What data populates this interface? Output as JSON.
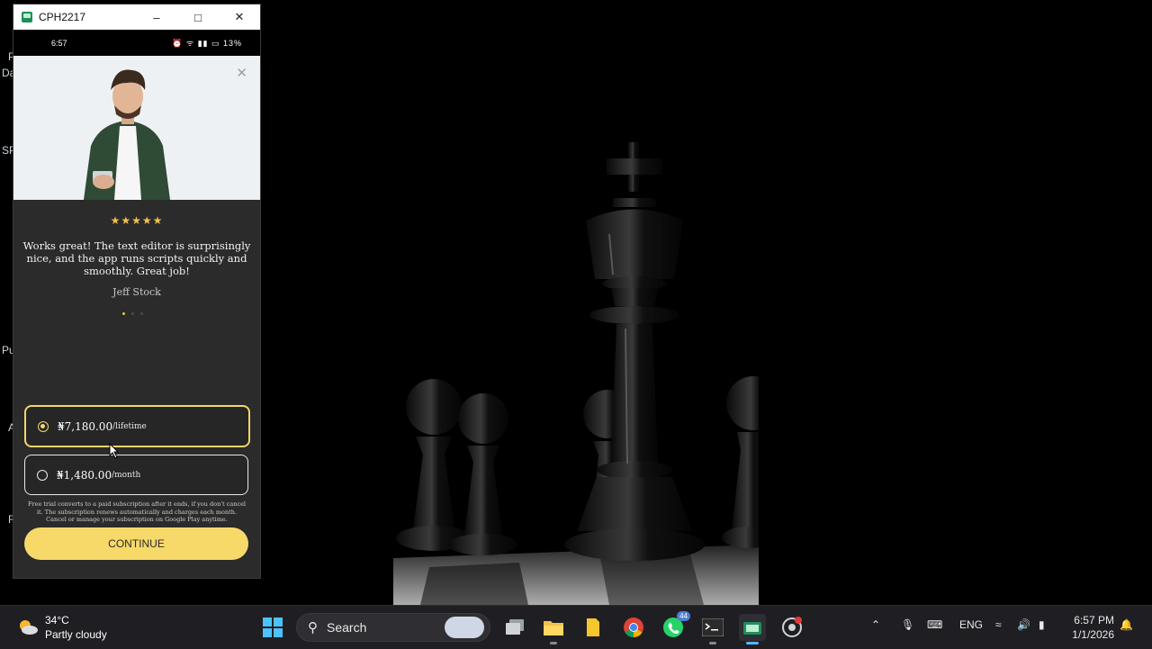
{
  "desktop_fragments": [
    "P",
    "Da",
    "SP",
    "Pu",
    "A",
    "R"
  ],
  "window": {
    "title": "CPH2217"
  },
  "phone": {
    "status": {
      "time": "6:57",
      "battery": "13%"
    },
    "testimonial": {
      "stars": "★★★★★",
      "quote": "Works great! The text editor is surprisingly nice, and the app runs scripts quickly and smoothly. Great job!",
      "author": "Jeff Stock"
    },
    "plans": [
      {
        "price": "₦7,180.00",
        "period": "/lifetime",
        "selected": true
      },
      {
        "price": "₦1,480.00",
        "period": "/month",
        "selected": false
      }
    ],
    "disclaimer": "Free trial converts to a paid subscription after it ends, if you don't cancel it. The subscription renews automatically and charges each month. Cancel or manage your subscription on Google Play anytime.",
    "cta": "CONTINUE",
    "accent_color": "#f7d96a"
  },
  "taskbar": {
    "weather": {
      "temp": "34°C",
      "condition": "Partly cloudy"
    },
    "search_label": "Search",
    "whatsapp_badge": "44",
    "language": "ENG",
    "clock": {
      "time": "6:57 PM",
      "date": "1/1/2026"
    }
  }
}
